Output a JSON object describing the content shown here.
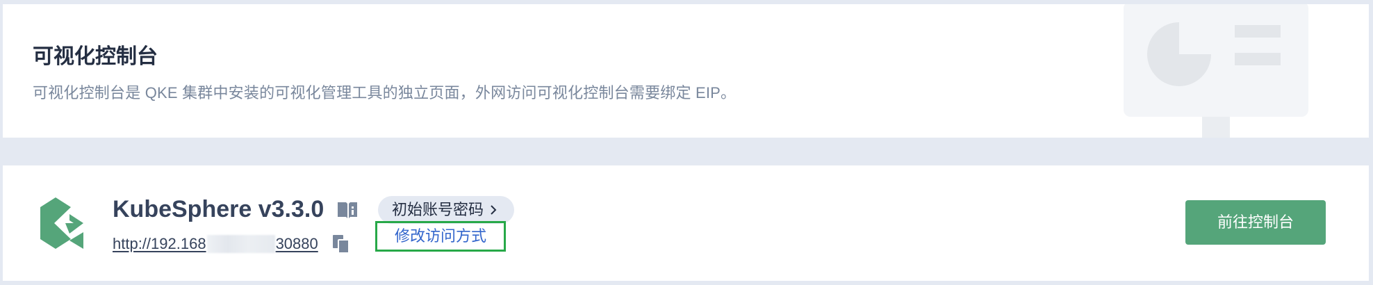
{
  "banner": {
    "title": "可视化控制台",
    "description": "可视化控制台是 QKE 集群中安装的可视化管理工具的独立页面，外网访问可视化控制台需要绑定 EIP。",
    "illustration_icon": "dashboard-monitor-illustration"
  },
  "app": {
    "name": "KubeSphere v3.3.0",
    "logo_icon": "kubesphere-logo-icon",
    "doc_icon": "document-book-icon",
    "account_chip_label": "初始账号密码",
    "url_prefix": "http://192.168",
    "url_suffix": "30880",
    "copy_icon": "copy-icon",
    "edit_access_label": "修改访问方式",
    "goto_console_label": "前往控制台"
  },
  "colors": {
    "page_background": "#e4e9f2",
    "card_background": "#ffffff",
    "primary_button": "#55a57a",
    "link_blue": "#3366cc",
    "highlight_border": "#27a848",
    "logo_green": "#55a57a"
  }
}
